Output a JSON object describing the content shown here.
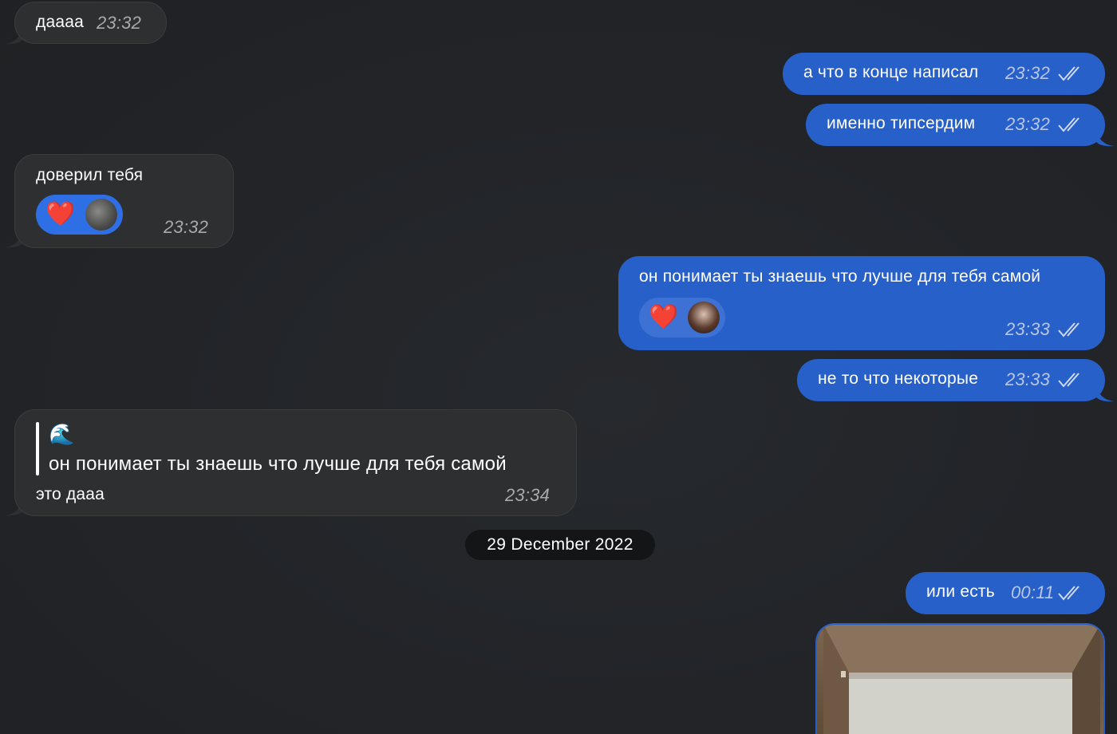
{
  "messages": [
    {
      "text": "даааа",
      "time": "23:32"
    },
    {
      "text": "а что в конце написал",
      "time": "23:32"
    },
    {
      "text": "именно типсердим",
      "time": "23:32"
    },
    {
      "text": "доверил тебя",
      "time": "23:32",
      "reaction": "❤️"
    },
    {
      "text": "он понимает ты знаешь что лучше для тебя самой",
      "time": "23:33",
      "reaction": "❤️"
    },
    {
      "text": "не то что некоторые",
      "time": "23:33"
    },
    {
      "quote_sender_icon": "🌊",
      "quote_text": "он понимает ты знаешь что лучше для тебя самой",
      "text": "это дааа",
      "time": "23:34"
    },
    {
      "text": "или есть",
      "time": "00:11"
    }
  ],
  "date_separator": "29 December 2022",
  "colors": {
    "outgoing": "#2860c9",
    "incoming": "#2e2f31",
    "background": "#222428"
  },
  "icons": [
    "double-check-icon",
    "heart-reaction-icon",
    "avatar",
    "wave-emoji-icon"
  ]
}
